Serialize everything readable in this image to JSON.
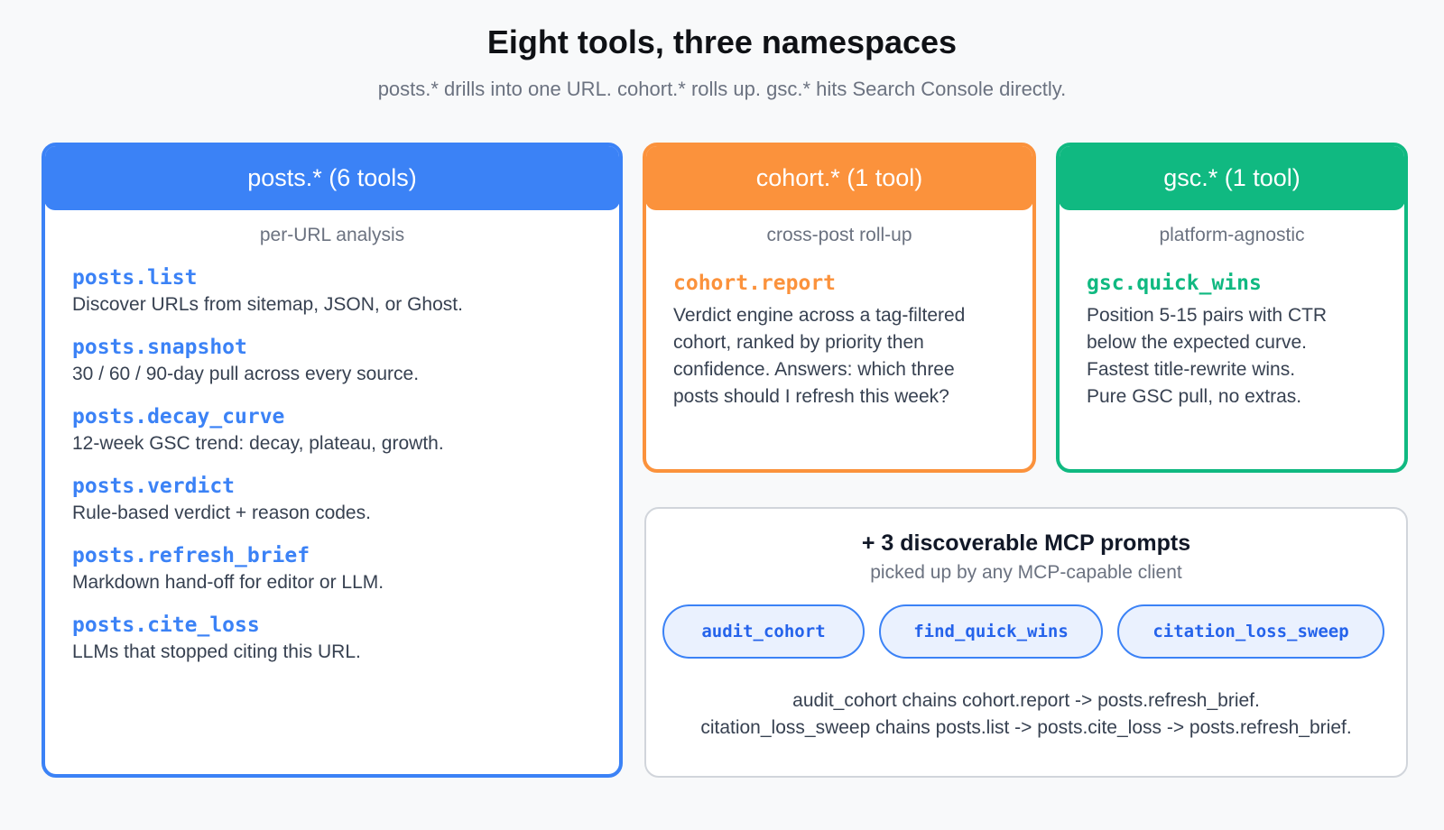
{
  "header": {
    "title": "Eight tools, three namespaces",
    "subtitle": "posts.* drills into one URL. cohort.* rolls up. gsc.* hits Search Console directly."
  },
  "posts": {
    "heading": "posts.* (6 tools)",
    "sub": "per-URL analysis",
    "tools": [
      {
        "name": "posts.list",
        "desc": "Discover URLs from sitemap, JSON, or Ghost."
      },
      {
        "name": "posts.snapshot",
        "desc": "30 / 60 / 90-day pull across every source."
      },
      {
        "name": "posts.decay_curve",
        "desc": "12-week GSC trend: decay, plateau, growth."
      },
      {
        "name": "posts.verdict",
        "desc": "Rule-based verdict + reason codes."
      },
      {
        "name": "posts.refresh_brief",
        "desc": "Markdown hand-off for editor or LLM."
      },
      {
        "name": "posts.cite_loss",
        "desc": "LLMs that stopped citing this URL."
      }
    ],
    "color": "#3b82f6"
  },
  "cohort": {
    "heading": "cohort.* (1 tool)",
    "sub": "cross-post roll-up",
    "tool_name": "cohort.report",
    "tool_desc_lines": [
      "Verdict engine across a tag-filtered",
      "cohort, ranked by priority then",
      "confidence. Answers: which three",
      "posts should I refresh this week?"
    ],
    "color": "#fb923c"
  },
  "gsc": {
    "heading": "gsc.* (1 tool)",
    "sub": "platform-agnostic",
    "tool_name": "gsc.quick_wins",
    "tool_desc_lines": [
      "Position 5-15 pairs with CTR",
      "below the expected curve.",
      "Fastest title-rewrite wins.",
      "Pure GSC pull, no extras."
    ],
    "color": "#10b981"
  },
  "prompts": {
    "title": "+ 3 discoverable MCP prompts",
    "sub": "picked up by any MCP-capable client",
    "items": [
      "audit_cohort",
      "find_quick_wins",
      "citation_loss_sweep"
    ],
    "chains": [
      "audit_cohort chains cohort.report -> posts.refresh_brief.",
      "citation_loss_sweep chains posts.list -> posts.cite_loss -> posts.refresh_brief."
    ]
  }
}
